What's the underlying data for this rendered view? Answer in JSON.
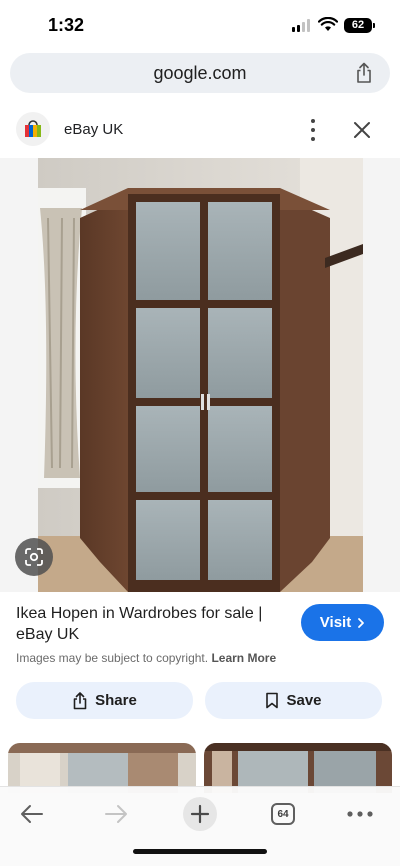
{
  "status_bar": {
    "time": "1:32",
    "battery": "62"
  },
  "url_bar": {
    "url": "google.com"
  },
  "header": {
    "site_name": "eBay UK"
  },
  "result": {
    "title": "Ikea Hopen in Wardrobes for sale | eBay UK",
    "visit_label": "Visit",
    "copyright_text": "Images may be subject to copyright.",
    "learn_more": "Learn More"
  },
  "actions": {
    "share_label": "Share",
    "save_label": "Save"
  },
  "toolbar": {
    "tab_count": "64"
  },
  "icons": {
    "share": "share-icon",
    "more": "more-vert-icon",
    "close": "close-icon",
    "lens": "google-lens-icon",
    "bookmark": "bookmark-icon",
    "back": "back-arrow-icon",
    "forward": "forward-arrow-icon",
    "new_tab": "plus-icon",
    "tabs": "tabs-icon",
    "menu": "more-horiz-icon"
  },
  "colors": {
    "accent": "#1a73e8",
    "action_bg": "#eaf1fc",
    "url_bar_bg": "#eceff3"
  }
}
